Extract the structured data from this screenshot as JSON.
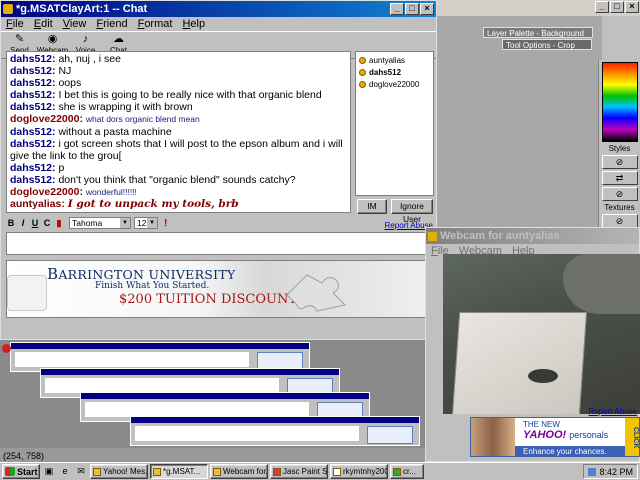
{
  "paint_bg": {
    "layer_palette_title": "Layer Palette - Background",
    "tool_options_title": "Tool Options - Crop",
    "styles_label": "Styles",
    "textures_label": "Textures"
  },
  "chat": {
    "title": "*g.MSATClayArt:1 -- Chat",
    "menu": [
      "File",
      "Edit",
      "View",
      "Friend",
      "Format",
      "Help"
    ],
    "toolbar": [
      "Send File",
      "Webcam",
      "Voice",
      "Chat"
    ],
    "messages": [
      {
        "user": "dahs512",
        "text": "ah, nuj , i see",
        "style": "normal"
      },
      {
        "user": "dahs512",
        "text": "NJ",
        "style": "normal"
      },
      {
        "user": "dahs512",
        "text": "oops",
        "style": "normal"
      },
      {
        "user": "dahs512",
        "text": "I bet this is going to be really nice with that organic blend",
        "style": "normal"
      },
      {
        "user": "dahs512",
        "text": "she is wrapping it with brown",
        "style": "normal"
      },
      {
        "user": "doglove22000",
        "text": "what dors organic blend mean",
        "style": "small"
      },
      {
        "user": "dahs512",
        "text": "without a pasta machine",
        "style": "normal"
      },
      {
        "user": "dahs512",
        "text": "i got screen shots that I will post to the epson album and i will give the link to the grou[",
        "style": "normal"
      },
      {
        "user": "dahs512",
        "text": "p",
        "style": "normal"
      },
      {
        "user": "dahs512",
        "text": "don't you think that \"organic blend\" sounds catchy?",
        "style": "normal"
      },
      {
        "user": "doglove22000",
        "text": "wonderful!!!!!!",
        "style": "small"
      },
      {
        "user": "auntyalias",
        "text": "I got to unpack my tools, brb",
        "style": "cursive"
      }
    ],
    "users": [
      "auntyalias",
      "dahs512",
      "doglove22000"
    ],
    "im_button": "IM",
    "ignore_button": "Ignore User",
    "format_buttons": [
      "B",
      "I",
      "U",
      "C"
    ],
    "font_name": "Tahoma",
    "font_size": "12",
    "report_abuse": "Report Abuse",
    "input_value": "",
    "ad": {
      "university": "BARRINGTON UNIVERSITY",
      "tagline": "Finish What You Started.",
      "discount": "$200 TUITION DISCOUNT"
    }
  },
  "webcam": {
    "title": "Webcam for auntyalias",
    "menu": [
      "File",
      "Webcam",
      "Help"
    ],
    "report_abuse": "Report Abuse",
    "ad": {
      "line1": "THE NEW",
      "brand": "YAHOO!",
      "product": "personals",
      "slogan": "Enhance your chances.",
      "click": "CLICK"
    }
  },
  "status_coords": "(254, 758)",
  "taskbar": {
    "start": "Start",
    "tasks": [
      "Yahoo! Mes...",
      "*g.MSAT...",
      "Webcam for...",
      "Jasc Paint S...",
      "rkymtnhy200...",
      "cr..."
    ],
    "active_task": 1,
    "clock": "8:42 PM"
  }
}
